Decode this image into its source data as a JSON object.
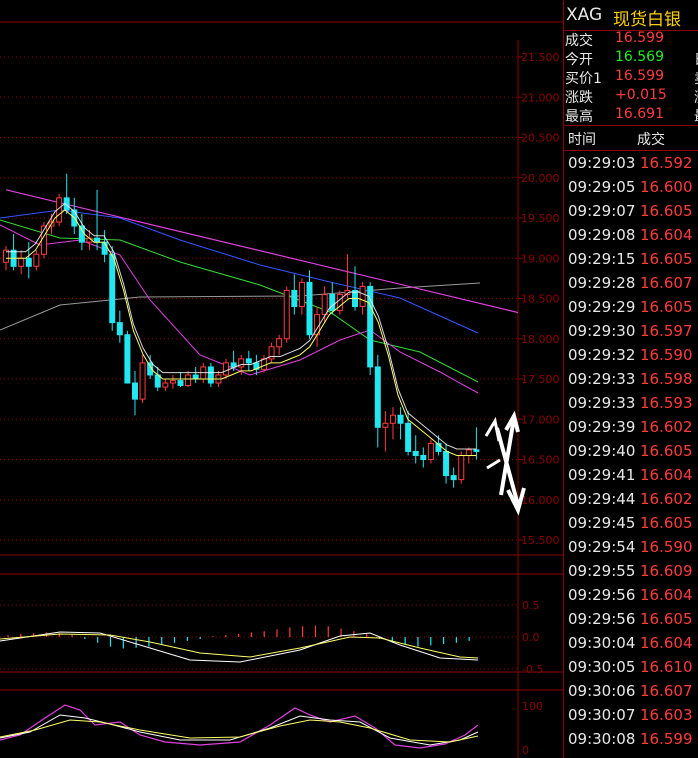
{
  "header": {
    "symbol": "XAG",
    "name": "现货白银"
  },
  "quote": [
    {
      "label": "成交",
      "value": "16.599",
      "color": "#ff3b3b",
      "cut": ""
    },
    {
      "label": "今开",
      "value": "16.569",
      "color": "#22ee22",
      "cut": "日"
    },
    {
      "label": "买价1",
      "value": "16.599",
      "color": "#ff3b3b",
      "cut": "卖"
    },
    {
      "label": "涨跌",
      "value": "+0.015",
      "color": "#ff3b3b",
      "cut": "涨"
    },
    {
      "label": "最高",
      "value": "16.691",
      "color": "#ff3b3b",
      "cut": "最"
    }
  ],
  "ticks_header": {
    "time": "时间",
    "price": "成交"
  },
  "ticks": [
    {
      "time": "09:29:03",
      "price": "16.592"
    },
    {
      "time": "09:29:05",
      "price": "16.600"
    },
    {
      "time": "09:29:07",
      "price": "16.605"
    },
    {
      "time": "09:29:08",
      "price": "16.604"
    },
    {
      "time": "09:29:15",
      "price": "16.605"
    },
    {
      "time": "09:29:28",
      "price": "16.607"
    },
    {
      "time": "09:29:29",
      "price": "16.605"
    },
    {
      "time": "09:29:30",
      "price": "16.597"
    },
    {
      "time": "09:29:32",
      "price": "16.590"
    },
    {
      "time": "09:29:33",
      "price": "16.598"
    },
    {
      "time": "09:29:33",
      "price": "16.593"
    },
    {
      "time": "09:29:39",
      "price": "16.602"
    },
    {
      "time": "09:29:40",
      "price": "16.605"
    },
    {
      "time": "09:29:41",
      "price": "16.604"
    },
    {
      "time": "09:29:44",
      "price": "16.602"
    },
    {
      "time": "09:29:45",
      "price": "16.605"
    },
    {
      "time": "09:29:54",
      "price": "16.590"
    },
    {
      "time": "09:29:55",
      "price": "16.609"
    },
    {
      "time": "09:29:56",
      "price": "16.604"
    },
    {
      "time": "09:29:56",
      "price": "16.605"
    },
    {
      "time": "09:30:04",
      "price": "16.604"
    },
    {
      "time": "09:30:05",
      "price": "16.610"
    },
    {
      "time": "09:30:06",
      "price": "16.607"
    },
    {
      "time": "09:30:07",
      "price": "16.603"
    },
    {
      "time": "09:30:08",
      "price": "16.599"
    }
  ],
  "price_axis": {
    "labels": [
      "21.500",
      "21.000",
      "20.500",
      "20.000",
      "19.500",
      "19.000",
      "18.500",
      "18.000",
      "17.500",
      "17.000",
      "16.500",
      "16.000",
      "15.500"
    ],
    "min": 15.5,
    "max": 21.5
  },
  "macd_axis": {
    "labels": [
      "0.5",
      "0.0",
      "-0.5"
    ]
  },
  "kdj_axis": {
    "labels": [
      "100",
      "0"
    ]
  },
  "colors": {
    "up": "#ff3b3b",
    "down": "#22e6f0",
    "grid": "#8b0000",
    "trendline": "#e040e0",
    "ma5": "#ffffff",
    "ma10": "#ffff66",
    "ma20": "#e040e0",
    "ma30": "#33dd33",
    "ma60": "#3355ff",
    "ma120": "#999999"
  },
  "chart_data": {
    "type": "candlestick",
    "ohlc": [
      [
        18.95,
        19.15,
        18.85,
        19.1
      ],
      [
        19.1,
        19.3,
        18.85,
        18.9
      ],
      [
        18.9,
        19.1,
        18.8,
        19.0
      ],
      [
        19.0,
        19.2,
        18.75,
        18.9
      ],
      [
        18.9,
        19.1,
        18.85,
        19.05
      ],
      [
        19.05,
        19.45,
        19.0,
        19.4
      ],
      [
        19.4,
        19.55,
        19.3,
        19.45
      ],
      [
        19.45,
        19.8,
        19.4,
        19.75
      ],
      [
        19.75,
        20.05,
        19.55,
        19.6
      ],
      [
        19.6,
        19.75,
        19.3,
        19.4
      ],
      [
        19.4,
        19.55,
        19.1,
        19.2
      ],
      [
        19.2,
        19.35,
        19.1,
        19.25
      ],
      [
        19.25,
        19.85,
        19.1,
        19.2
      ],
      [
        19.2,
        19.35,
        18.95,
        19.05
      ],
      [
        19.05,
        19.15,
        18.1,
        18.2
      ],
      [
        18.2,
        18.35,
        17.95,
        18.05
      ],
      [
        18.05,
        18.1,
        17.45,
        17.45
      ],
      [
        17.45,
        17.6,
        17.05,
        17.25
      ],
      [
        17.25,
        17.8,
        17.2,
        17.7
      ],
      [
        17.7,
        17.8,
        17.5,
        17.55
      ],
      [
        17.55,
        17.65,
        17.35,
        17.4
      ],
      [
        17.4,
        17.5,
        17.35,
        17.45
      ],
      [
        17.45,
        17.55,
        17.38,
        17.48
      ],
      [
        17.48,
        17.58,
        17.4,
        17.42
      ],
      [
        17.42,
        17.6,
        17.4,
        17.55
      ],
      [
        17.55,
        17.65,
        17.45,
        17.5
      ],
      [
        17.5,
        17.7,
        17.45,
        17.65
      ],
      [
        17.65,
        17.7,
        17.4,
        17.45
      ],
      [
        17.45,
        17.6,
        17.4,
        17.55
      ],
      [
        17.55,
        17.75,
        17.5,
        17.7
      ],
      [
        17.7,
        17.85,
        17.6,
        17.65
      ],
      [
        17.65,
        17.8,
        17.55,
        17.75
      ],
      [
        17.75,
        17.85,
        17.6,
        17.7
      ],
      [
        17.7,
        17.8,
        17.55,
        17.62
      ],
      [
        17.62,
        17.8,
        17.58,
        17.75
      ],
      [
        17.75,
        17.95,
        17.7,
        17.9
      ],
      [
        17.9,
        18.05,
        17.8,
        18.0
      ],
      [
        18.0,
        18.65,
        17.95,
        18.6
      ],
      [
        18.6,
        18.8,
        18.3,
        18.4
      ],
      [
        18.4,
        18.75,
        18.3,
        18.7
      ],
      [
        18.7,
        18.85,
        18.0,
        18.05
      ],
      [
        18.05,
        18.4,
        17.9,
        18.3
      ],
      [
        18.3,
        18.65,
        18.2,
        18.55
      ],
      [
        18.55,
        18.7,
        18.3,
        18.35
      ],
      [
        18.35,
        18.6,
        18.3,
        18.55
      ],
      [
        18.55,
        19.05,
        18.5,
        18.6
      ],
      [
        18.6,
        18.9,
        18.35,
        18.4
      ],
      [
        18.4,
        18.7,
        18.3,
        18.65
      ],
      [
        18.65,
        18.7,
        17.55,
        17.65
      ],
      [
        17.65,
        17.8,
        16.65,
        16.9
      ],
      [
        16.9,
        17.1,
        16.6,
        16.95
      ],
      [
        16.95,
        17.15,
        16.75,
        17.05
      ],
      [
        17.05,
        17.15,
        16.75,
        16.95
      ],
      [
        16.95,
        17.1,
        16.55,
        16.6
      ],
      [
        16.6,
        16.8,
        16.45,
        16.55
      ],
      [
        16.55,
        16.65,
        16.4,
        16.5
      ],
      [
        16.5,
        16.75,
        16.45,
        16.7
      ],
      [
        16.7,
        16.8,
        16.55,
        16.6
      ],
      [
        16.6,
        16.7,
        16.2,
        16.3
      ],
      [
        16.3,
        16.4,
        16.15,
        16.25
      ],
      [
        16.25,
        16.6,
        16.2,
        16.55
      ],
      [
        16.55,
        16.65,
        16.45,
        16.62
      ],
      [
        16.62,
        16.9,
        16.5,
        16.6
      ]
    ],
    "trendline": [
      [
        0,
        19.85
      ],
      [
        62,
        18.45
      ]
    ],
    "ma5": [
      19.0,
      19.0,
      19.0,
      19.1,
      19.3,
      19.5,
      19.6,
      19.5,
      19.3,
      19.2,
      19.2,
      19.0,
      18.6,
      18.1,
      17.8,
      17.6,
      17.5,
      17.5,
      17.5,
      17.5,
      17.5,
      17.5,
      17.5,
      17.55,
      17.6,
      17.6,
      17.65,
      17.7,
      17.7,
      17.75,
      17.8,
      17.9,
      18.1,
      18.3,
      18.4,
      18.5,
      18.5,
      18.45,
      18.2,
      17.8,
      17.3,
      17.0,
      16.9,
      16.8,
      16.7,
      16.6,
      16.55,
      16.55,
      16.55
    ],
    "macd_bars": [
      0.05,
      0.08,
      0.1,
      0.12,
      0.1,
      0.06,
      -0.05,
      -0.15,
      -0.25,
      -0.3,
      -0.28,
      -0.25,
      -0.2,
      -0.15,
      -0.1,
      -0.05,
      0.02,
      0.05,
      0.08,
      0.12,
      0.15,
      0.2,
      0.25,
      0.28,
      0.3,
      0.28,
      0.22,
      0.15,
      0.08,
      -0.05,
      -0.15,
      -0.2,
      -0.25,
      -0.22,
      -0.18,
      -0.15,
      -0.1
    ]
  }
}
